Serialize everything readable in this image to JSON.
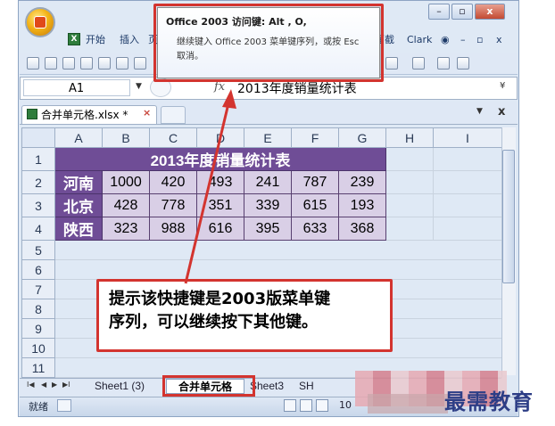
{
  "keytip": {
    "title": "Office 2003 访问键: Alt , O,",
    "body": "继续键入 Office 2003 菜单键序列，或按 Esc 取消。"
  },
  "ribbon": {
    "tabs": [
      "开始",
      "插入",
      "页",
      "面截",
      "Clark"
    ],
    "help_icon": "help-icon",
    "minimize": "–",
    "restore": "▫",
    "close": "x"
  },
  "window_controls": [
    "–",
    "▫",
    "x"
  ],
  "formula_bar": {
    "name_box": "A1",
    "fx": "fx",
    "content": "2013年度销量统计表",
    "expand": "¥"
  },
  "document": {
    "tab_title": "合并单元格.xlsx *",
    "tab_close": "×",
    "scroll_btn": "▼",
    "close_btn": "x"
  },
  "sheet": {
    "columns": [
      "A",
      "B",
      "C",
      "D",
      "E",
      "F",
      "G",
      "H",
      "I"
    ],
    "rows": [
      "1",
      "2",
      "3",
      "4",
      "5",
      "6",
      "7",
      "8",
      "9",
      "10",
      "11"
    ],
    "title": "2013年度销量统计表",
    "data": [
      {
        "city": "河南",
        "values": [
          "1000",
          "420",
          "493",
          "241",
          "787",
          "239"
        ]
      },
      {
        "city": "北京",
        "values": [
          "428",
          "778",
          "351",
          "339",
          "615",
          "193"
        ]
      },
      {
        "city": "陕西",
        "values": [
          "323",
          "988",
          "616",
          "395",
          "633",
          "368"
        ]
      }
    ]
  },
  "sheet_tabs": {
    "nav": [
      "I◀",
      "◀",
      "▶",
      "▶I"
    ],
    "tabs": [
      "Sheet1 (3)",
      "合并单元格",
      "Sheet3",
      "SH"
    ],
    "active": "合并单元格"
  },
  "status_bar": {
    "ready": "就绪",
    "zoom": "10"
  },
  "callout": {
    "line1": "提示该快捷键是2003版菜单键",
    "line2": "序列，可以继续按下其他键。"
  },
  "watermark": "最需教育",
  "colors": {
    "highlight_red": "#d3342f",
    "title_purple": "#6f4d96",
    "data_lavender": "#d9cfe6"
  }
}
